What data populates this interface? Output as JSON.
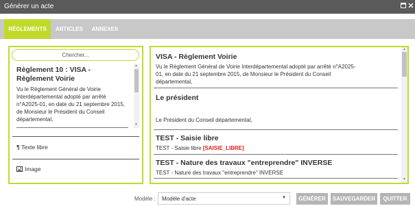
{
  "window": {
    "title": "Générer un acte"
  },
  "tabs": [
    {
      "label": "RÈGLEMENTS",
      "active": true
    },
    {
      "label": "ARTICLES",
      "active": false
    },
    {
      "label": "ANNEXES",
      "active": false
    }
  ],
  "left": {
    "search_label": "Chercher...",
    "item": {
      "title": "Règlement 10 : VISA - Règlement Voirie",
      "body": "Vu le Règlement Général de Voirie Interdépartemental adopté par arrêté n°A2025-01, en date du 21 septembre 2015, de Monsieur le Président du Conseil départemental,"
    },
    "free_text_label": "Texte libre",
    "image_label": "Image"
  },
  "right": {
    "items": [
      {
        "title": "VISA - Règlement Voirie",
        "body": "Vu le Règlement Général de Voirie Interdépartemental adopté par arrêté n°A2025-01, en date du 21 septembre 2015, de Monsieur le Président du Conseil départemental,"
      },
      {
        "title": "Le président",
        "body": "Le Président du Conseil départemental,"
      },
      {
        "title": "TEST - Saisie libre",
        "body": "TEST - Saisie libre ",
        "tag": "[SAISIE_LIBRE]"
      },
      {
        "title": "TEST - Nature des travaux \"entreprendre\" INVERSE",
        "body": "TEST - Nature des travaux \"entreprendre\" INVERSE"
      }
    ]
  },
  "footer": {
    "model_label": "Modèle :",
    "model_value": "Modèle d'acte",
    "buttons": {
      "generate": "GÉNÉRER",
      "save": "SAUVEGARDER",
      "quit": "QUITTER"
    }
  },
  "colors": {
    "accent": "#c2d92a",
    "tag_red": "#e02020",
    "titlebar": "#5a5a5a",
    "tabsbar": "#c8c8c8",
    "button": "#b5b5b5"
  }
}
